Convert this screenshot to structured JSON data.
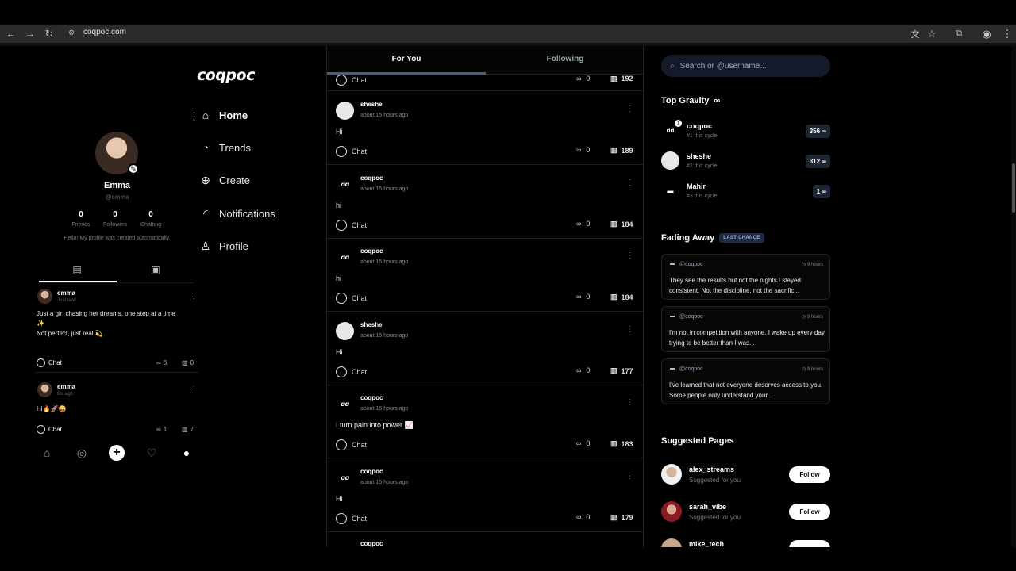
{
  "browser": {
    "url": "coqpoc.com"
  },
  "profile": {
    "name": "Emma",
    "handle": "@emma",
    "stats": [
      {
        "value": "0",
        "label": "Friends"
      },
      {
        "value": "0",
        "label": "Followers"
      },
      {
        "value": "0",
        "label": "Chatting"
      }
    ],
    "bio": "Hello! My profile was created automatically.",
    "posts": [
      {
        "user": "emma",
        "time": "Just now",
        "line1": "Just a girl chasing her dreams, one step at a time",
        "line2": "✨",
        "line3": "Not perfect, just real 💫",
        "chat": "Chat",
        "infinity": "0",
        "views": "0"
      },
      {
        "user": "emma",
        "time": "8m ago",
        "line1": "Hi🔥🚀😜",
        "chat": "Chat",
        "infinity": "1",
        "views": "7"
      }
    ]
  },
  "nav": {
    "logo": "coqpoc",
    "items": [
      {
        "label": "Home",
        "icon": "home-icon"
      },
      {
        "label": "Trends",
        "icon": "trends-icon"
      },
      {
        "label": "Create",
        "icon": "create-icon"
      },
      {
        "label": "Notifications",
        "icon": "bell-icon"
      },
      {
        "label": "Profile",
        "icon": "profile-icon"
      }
    ]
  },
  "feed": {
    "tabs": {
      "for_you": "For You",
      "following": "Following"
    },
    "top_row": {
      "chat": "Chat",
      "infinity": "0",
      "views": "192"
    },
    "posts": [
      {
        "user": "sheshe",
        "time": "about 15 hours ago",
        "body": "Hi",
        "chat": "Chat",
        "infinity": "0",
        "views": "189",
        "avatar": "white"
      },
      {
        "user": "coqpoc",
        "time": "about 15 hours ago",
        "body": "hi",
        "chat": "Chat",
        "infinity": "0",
        "views": "184",
        "avatar": "logo"
      },
      {
        "user": "coqpoc",
        "time": "about 15 hours ago",
        "body": "hi",
        "chat": "Chat",
        "infinity": "0",
        "views": "184",
        "avatar": "logo"
      },
      {
        "user": "sheshe",
        "time": "about 15 hours ago",
        "body": "Hi",
        "chat": "Chat",
        "infinity": "0",
        "views": "177",
        "avatar": "white"
      },
      {
        "user": "coqpoc",
        "time": "about 16 hours ago",
        "body": "I turn pain into power 📈",
        "chat": "Chat",
        "infinity": "0",
        "views": "183",
        "avatar": "logo"
      },
      {
        "user": "coqpoc",
        "time": "about 15 hours ago",
        "body": "Hi",
        "chat": "Chat",
        "infinity": "0",
        "views": "179",
        "avatar": "logo"
      }
    ],
    "cutoff_user": "coqpoc"
  },
  "right": {
    "search_placeholder": "Search or @username...",
    "top_gravity": {
      "title": "Top Gravity",
      "entries": [
        {
          "user": "coqpoc",
          "sub": "#1 this cycle",
          "score": "356 ∞"
        },
        {
          "user": "sheshe",
          "sub": "#2 this cycle",
          "score": "312 ∞"
        },
        {
          "user": "Mahir",
          "sub": "#3 this cycle",
          "score": "1 ∞"
        }
      ]
    },
    "fading_away": {
      "title": "Fading Away",
      "badge": "LAST CHANCE",
      "cards": [
        {
          "user": "@coqpoc",
          "time": "9 hours",
          "text": "They see the results but not the nights I stayed consistent. Not the discipline, not the sacrific..."
        },
        {
          "user": "@coqpoc",
          "time": "9 hours",
          "text": "I'm not in competition with anyone. I wake up every day trying to be better than I was..."
        },
        {
          "user": "@coqpoc",
          "time": "9 hours",
          "text": "I've learned that not everyone deserves access to you. Some people only understand your..."
        }
      ]
    },
    "suggested": {
      "title": "Suggested Pages",
      "entries": [
        {
          "user": "alex_streams",
          "sub": "Suggested for you",
          "button": "Follow"
        },
        {
          "user": "sarah_vibe",
          "sub": "Suggested for you",
          "button": "Follow"
        },
        {
          "user": "mike_tech",
          "sub": "",
          "button": ""
        }
      ]
    }
  }
}
